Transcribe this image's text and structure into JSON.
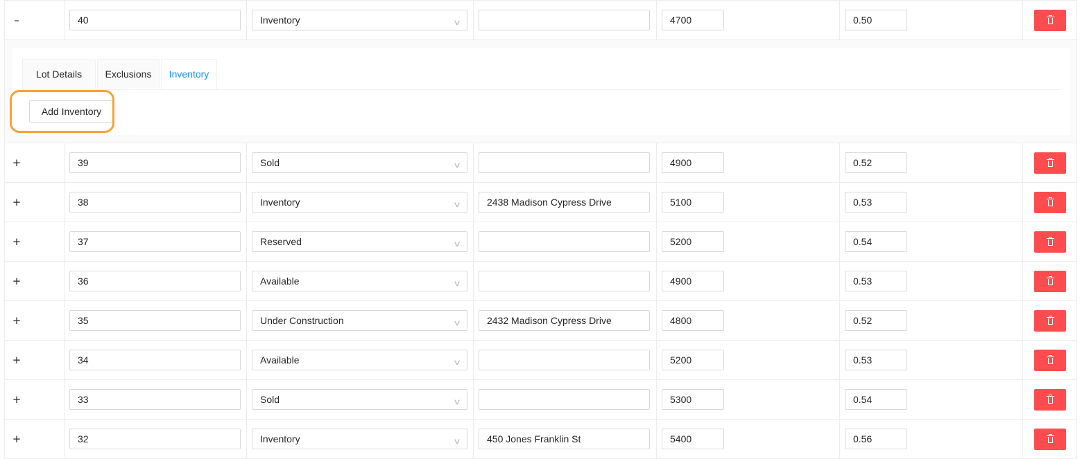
{
  "expanded_row": {
    "toggle": "–",
    "lot": "40",
    "status": "Inventory",
    "address": "",
    "size": "4700",
    "acreage": "0.50"
  },
  "tabs": [
    {
      "label": "Lot Details"
    },
    {
      "label": "Exclusions"
    },
    {
      "label": "Inventory"
    }
  ],
  "active_tab": "Inventory",
  "add_inventory_label": "Add Inventory",
  "highlight_color": "#f7a13a",
  "delete_color": "#ff4d4f",
  "rows": [
    {
      "toggle": "+",
      "lot": "39",
      "status": "Sold",
      "address": "",
      "size": "4900",
      "acreage": "0.52"
    },
    {
      "toggle": "+",
      "lot": "38",
      "status": "Inventory",
      "address": "2438 Madison Cypress Drive",
      "size": "5100",
      "acreage": "0.53"
    },
    {
      "toggle": "+",
      "lot": "37",
      "status": "Reserved",
      "address": "",
      "size": "5200",
      "acreage": "0.54"
    },
    {
      "toggle": "+",
      "lot": "36",
      "status": "Available",
      "address": "",
      "size": "4900",
      "acreage": "0.53"
    },
    {
      "toggle": "+",
      "lot": "35",
      "status": "Under Construction",
      "address": "2432 Madison Cypress Drive",
      "size": "4800",
      "acreage": "0.52"
    },
    {
      "toggle": "+",
      "lot": "34",
      "status": "Available",
      "address": "",
      "size": "5200",
      "acreage": "0.53"
    },
    {
      "toggle": "+",
      "lot": "33",
      "status": "Sold",
      "address": "",
      "size": "5300",
      "acreage": "0.54"
    },
    {
      "toggle": "+",
      "lot": "32",
      "status": "Inventory",
      "address": "450 Jones Franklin St",
      "size": "5400",
      "acreage": "0.56"
    }
  ],
  "icons": {
    "delete": "trash-icon",
    "select_arrow": "chevron-down-icon"
  }
}
